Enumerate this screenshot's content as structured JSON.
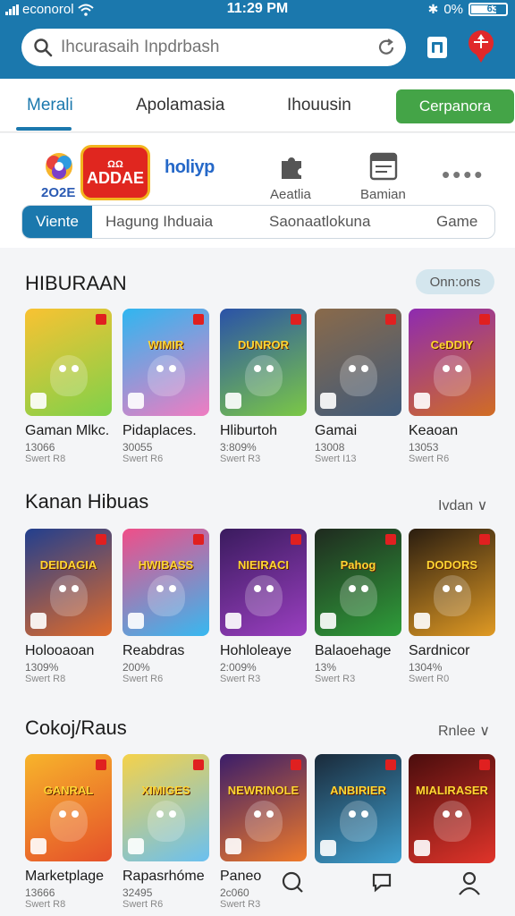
{
  "status": {
    "carrier": "econorol",
    "time": "11:29 PM",
    "battery_pct": "0%",
    "battery_label": "637"
  },
  "search": {
    "placeholder": "Ihcurasaih Inpdrbash"
  },
  "tabs": [
    {
      "label": "Merali",
      "active": true
    },
    {
      "label": "Apolamasia"
    },
    {
      "label": "Ihouusin"
    }
  ],
  "tab_cta": "Cerpanora",
  "categories": {
    "logo_year": "2O2E",
    "logo_red_top": "ΩΩ",
    "logo_red_main": "ADDAE",
    "logo_text": "holiyp",
    "items": [
      {
        "label": "Aeatlia",
        "icon": "puzzle-icon"
      },
      {
        "label": "Bamian",
        "icon": "store-icon"
      }
    ],
    "more": "••••"
  },
  "pills": [
    "Viente",
    "Hagung Ihduaia",
    "Saonaatlokuna",
    "Game"
  ],
  "sections": [
    {
      "title": "HIBURAAN",
      "link": "Onn:ons",
      "cards": [
        {
          "name": "Gaman Mlkc.",
          "meta1": "13066",
          "meta2": "Swert R8",
          "thumb_text": "",
          "colors": [
            "#f9c232",
            "#7fd14a"
          ]
        },
        {
          "name": "Pidaplaces.",
          "meta1": "30055",
          "meta2": "Swert R6",
          "thumb_text": "WIMIR",
          "colors": [
            "#2fb6f0",
            "#f07cc1"
          ]
        },
        {
          "name": "Hliburtoh",
          "meta1": "3:809%",
          "meta2": "Swert R3",
          "thumb_text": "DUNROR",
          "colors": [
            "#2a52a8",
            "#7bc846"
          ]
        },
        {
          "name": "Gamai",
          "meta1": "13008",
          "meta2": "Swert I13",
          "thumb_text": "",
          "colors": [
            "#8a6a4a",
            "#3f5a7a"
          ]
        },
        {
          "name": "Keaoan",
          "meta1": "13053",
          "meta2": "Swert R6",
          "thumb_text": "CeDDIY",
          "colors": [
            "#8e2bb0",
            "#d16d24"
          ]
        }
      ]
    },
    {
      "title": "Kanan Hibuas",
      "link": "Ivdan ∨",
      "cards": [
        {
          "name": "Holooaoan",
          "meta1": "1309%",
          "meta2": "Swert R8",
          "thumb_text": "DEIDAGIA",
          "colors": [
            "#223f8e",
            "#e06b2a"
          ]
        },
        {
          "name": "Reabdras",
          "meta1": "200%",
          "meta2": "Swert R6",
          "thumb_text": "HWIBASS",
          "colors": [
            "#f04e88",
            "#37b8f0"
          ]
        },
        {
          "name": "Hohloleaye",
          "meta1": "2:009%",
          "meta2": "Swert R3",
          "thumb_text": "NIEIRACI",
          "colors": [
            "#3a1b5e",
            "#9a3fc0"
          ]
        },
        {
          "name": "Balaoehage",
          "meta1": "13%",
          "meta2": "Swert R3",
          "thumb_text": "Pahog",
          "colors": [
            "#1f2a1f",
            "#2f9e3a"
          ]
        },
        {
          "name": "Sardnicor",
          "meta1": "1304%",
          "meta2": "Swert R0",
          "thumb_text": "DODORS",
          "colors": [
            "#2a1d10",
            "#e09a24"
          ]
        }
      ]
    },
    {
      "title": "Cokoj/Raus",
      "link": "Rnlee ∨",
      "cards": [
        {
          "name": "Marketplage",
          "meta1": "13666",
          "meta2": "Swert R8",
          "thumb_text": "GANRAL",
          "colors": [
            "#f7b42b",
            "#e5502a"
          ]
        },
        {
          "name": "Rapasrhóme",
          "meta1": "32495",
          "meta2": "Swert R6",
          "thumb_text": "XIMIGES",
          "colors": [
            "#f5d24a",
            "#6ac0f0"
          ]
        },
        {
          "name": "Paneo",
          "meta1": "2c060",
          "meta2": "Swert R3",
          "thumb_text": "NEWRINOLE",
          "colors": [
            "#3a1d6a",
            "#ef7a2a"
          ]
        },
        {
          "name": "",
          "meta1": "",
          "meta2": "",
          "thumb_text": "ANBIRIER",
          "colors": [
            "#1a2a3a",
            "#3fa0d0"
          ]
        },
        {
          "name": "",
          "meta1": "",
          "meta2": "",
          "thumb_text": "MIALIRASER",
          "colors": [
            "#4a0d0d",
            "#e0342a"
          ]
        }
      ]
    }
  ]
}
